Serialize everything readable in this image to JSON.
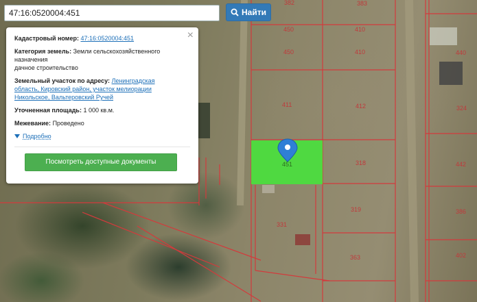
{
  "search": {
    "value": "47:16:0520004:451",
    "button_label": "Найти"
  },
  "popup": {
    "cadastral": {
      "label": "Кадастровый номер:",
      "value": "47:16:0520004:451"
    },
    "category": {
      "label": "Категория земель:",
      "value_line1": "Земли сельскохозяйственного",
      "value_line2": "назначения",
      "value_line3": "дачное строительство"
    },
    "address": {
      "label": "Земельный участок по адресу:",
      "value_line1": "Ленинградская",
      "value_line2": "область, Кировский район, участок мелиорации",
      "value_line3": "Никольское, Вальтеровский Ручей"
    },
    "area": {
      "label": "Уточненная площадь:",
      "value": "1 000 кв.м."
    },
    "survey": {
      "label": "Межевание:",
      "value": "Проведено"
    },
    "details_label": "Подробно",
    "documents_button": "Посмотреть доступные документы"
  },
  "map": {
    "highlight_color": "#44e83a",
    "boundary_color": "#d33a3c",
    "pin_color": "#2f7fd6",
    "pin_label": "451",
    "plot_numbers": [
      "382",
      "383",
      "450",
      "410",
      "450",
      "410",
      "411",
      "412",
      "318",
      "331",
      "319",
      "363",
      "324",
      "442",
      "386",
      "402",
      "440",
      "3"
    ]
  }
}
